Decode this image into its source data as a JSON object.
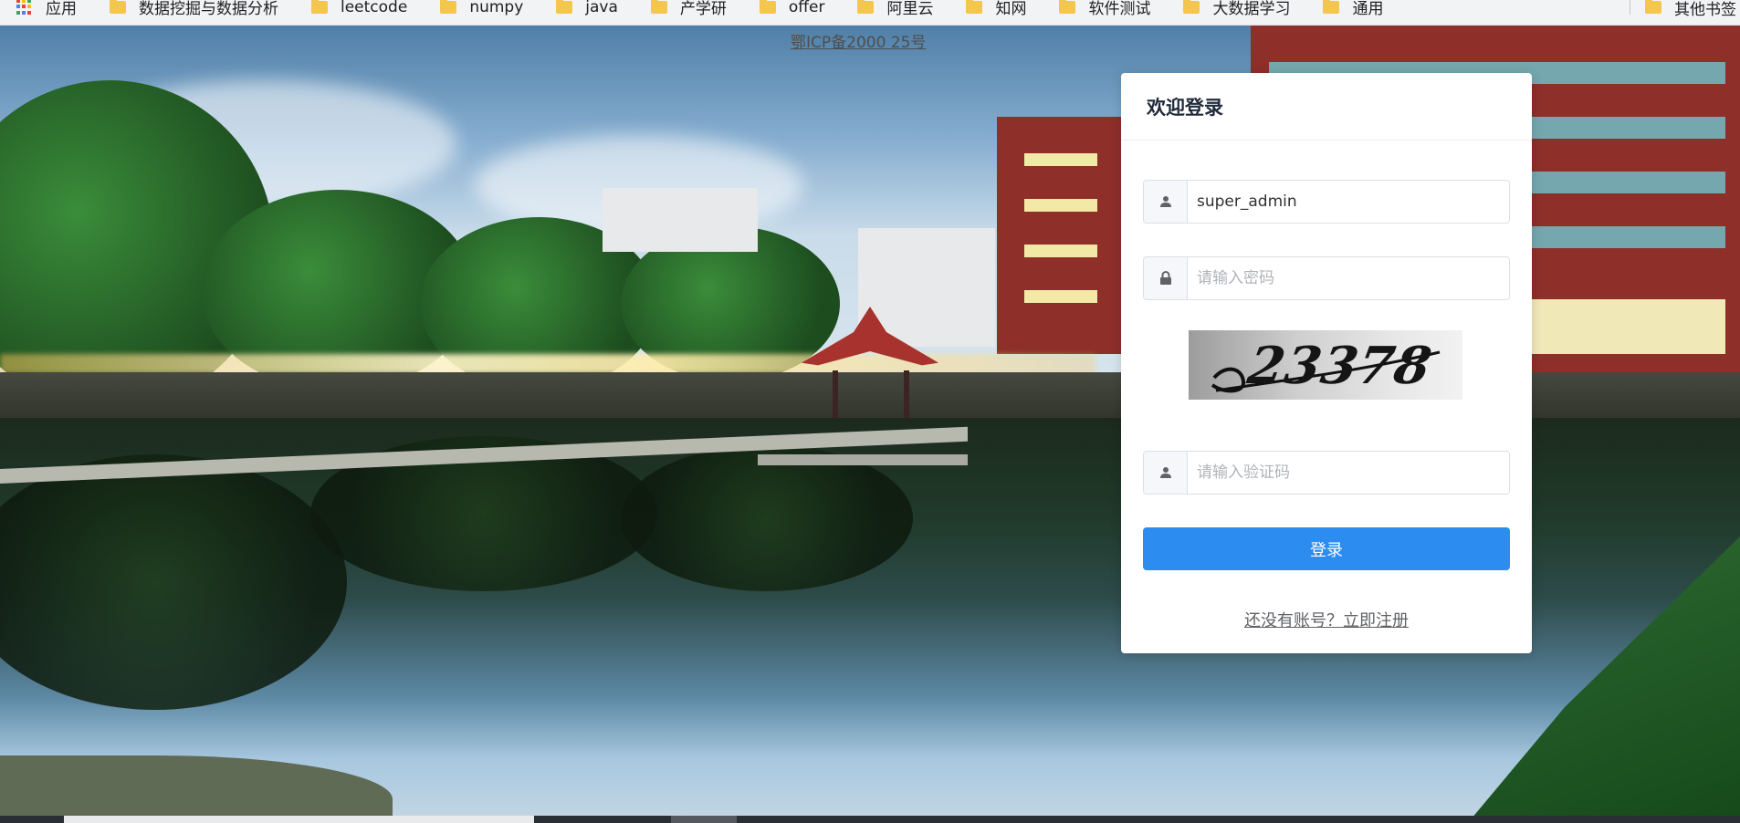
{
  "bookmarks": {
    "apps_label": "应用",
    "folders": [
      "数据挖掘与数据分析",
      "leetcode",
      "numpy",
      "java",
      "产学研",
      "offer",
      "阿里云",
      "知网",
      "软件测试",
      "大数据学习",
      "通用"
    ],
    "other_label": "其他书签"
  },
  "icp": {
    "text": "鄂ICP备2000 25号"
  },
  "login": {
    "title": "欢迎登录",
    "username_value": "super_admin",
    "password_placeholder": "请输入密码",
    "captcha_text": "23378",
    "code_placeholder": "请输入验证码",
    "submit_label": "登录",
    "register_link": "还没有账号？立即注册"
  },
  "colors": {
    "primary": "#2d8cf0",
    "card_bg": "#ffffff",
    "folder": "#f3c64e"
  },
  "icons": {
    "username": "user-icon",
    "password": "lock-icon",
    "captcha_field": "user-icon",
    "apps": "apps-grid-icon",
    "folder": "folder-icon"
  }
}
